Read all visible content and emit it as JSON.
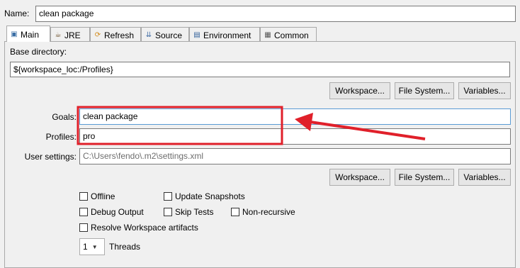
{
  "name": {
    "label": "Name:",
    "value": "clean package"
  },
  "tabs": [
    {
      "label": "Main",
      "icon": "main-tab-icon"
    },
    {
      "label": "JRE",
      "icon": "jre-icon"
    },
    {
      "label": "Refresh",
      "icon": "refresh-icon"
    },
    {
      "label": "Source",
      "icon": "source-icon"
    },
    {
      "label": "Environment",
      "icon": "environment-icon"
    },
    {
      "label": "Common",
      "icon": "common-icon"
    }
  ],
  "base_directory": {
    "label": "Base directory:",
    "value": "${workspace_loc:/Profiles}"
  },
  "buttons": {
    "workspace": "Workspace...",
    "filesystem": "File System...",
    "variables": "Variables..."
  },
  "goals": {
    "label": "Goals:",
    "value": "clean package"
  },
  "profiles": {
    "label": "Profiles:",
    "value": "pro"
  },
  "user_settings": {
    "label": "User settings:",
    "value": "C:\\Users\\fendo\\.m2\\settings.xml"
  },
  "options": {
    "offline": "Offline",
    "update_snapshots": "Update Snapshots",
    "debug_output": "Debug Output",
    "skip_tests": "Skip Tests",
    "non_recursive": "Non-recursive",
    "resolve_workspace": "Resolve Workspace artifacts"
  },
  "threads": {
    "value": "1",
    "label": "Threads"
  },
  "annotation": {
    "color": "#e0202a"
  }
}
